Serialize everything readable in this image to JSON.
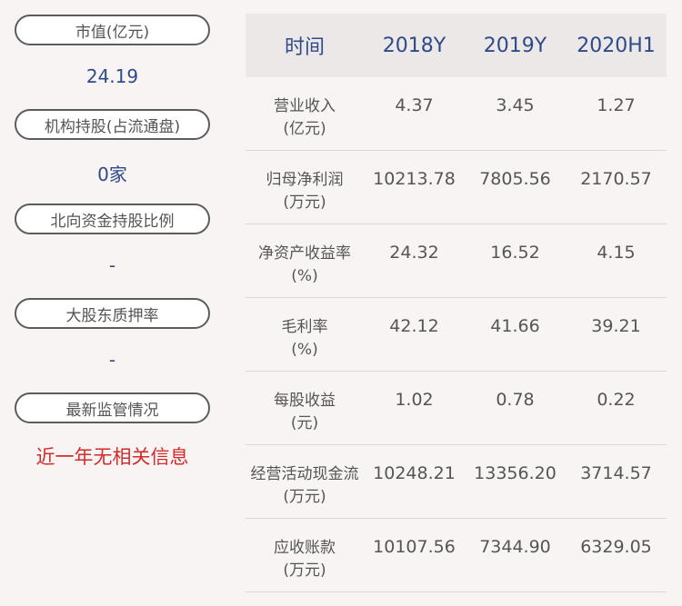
{
  "left_panel": {
    "items": [
      {
        "label": "市值(亿元)",
        "value": "24.19",
        "value_color": "#2e4a8a"
      },
      {
        "label": "机构持股(占流通盘)",
        "value": "0家",
        "value_color": "#2e4a8a"
      },
      {
        "label": "北向资金持股比例",
        "value": "-",
        "value_color": "#2e4a8a"
      },
      {
        "label": "大股东质押率",
        "value": "-",
        "value_color": "#2e4a8a"
      },
      {
        "label": "最新监管情况",
        "value": "近一年无相关信息",
        "value_color": "#d42a2a"
      }
    ]
  },
  "table": {
    "headers": [
      "时间",
      "2018Y",
      "2019Y",
      "2020H1"
    ],
    "rows": [
      {
        "label_line1": "营业收入",
        "label_line2": "(亿元)",
        "values": [
          "4.37",
          "3.45",
          "1.27"
        ]
      },
      {
        "label_line1": "归母净利润",
        "label_line2": "(万元)",
        "values": [
          "10213.78",
          "7805.56",
          "2170.57"
        ]
      },
      {
        "label_line1": "净资产收益率",
        "label_line2": "(%)",
        "values": [
          "24.32",
          "16.52",
          "4.15"
        ]
      },
      {
        "label_line1": "毛利率",
        "label_line2": "(%)",
        "values": [
          "42.12",
          "41.66",
          "39.21"
        ]
      },
      {
        "label_line1": "每股收益",
        "label_line2": "(元)",
        "values": [
          "1.02",
          "0.78",
          "0.22"
        ]
      },
      {
        "label_line1": "经营活动现金流",
        "label_line2": "(万元)",
        "values": [
          "10248.21",
          "13356.20",
          "3714.57"
        ]
      },
      {
        "label_line1": "应收账款",
        "label_line2": "(万元)",
        "values": [
          "10107.56",
          "7344.90",
          "6329.05"
        ]
      }
    ]
  },
  "colors": {
    "background": "#f8f4f4",
    "accent_blue": "#2e4a8a",
    "alert_red": "#d42a2a",
    "header_bg": "#ece8e8"
  }
}
